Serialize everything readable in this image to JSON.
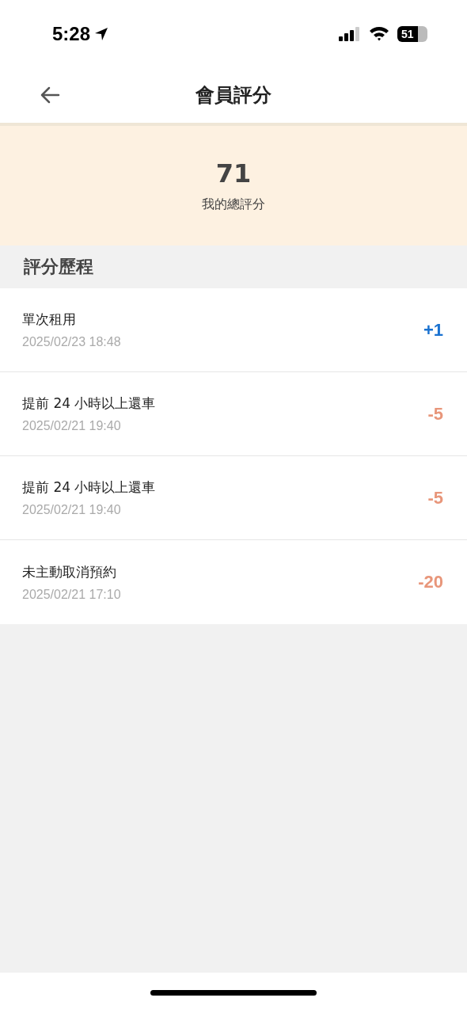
{
  "status_bar": {
    "time": "5:28",
    "battery": "51"
  },
  "header": {
    "title": "會員評分"
  },
  "summary": {
    "score": "71",
    "label": "我的總評分"
  },
  "section": {
    "title": "評分歷程"
  },
  "records": [
    {
      "title": "單次租用",
      "date": "2025/02/23 18:48",
      "points": "+1",
      "kind": "gain"
    },
    {
      "title": "提前 24 小時以上還車",
      "date": "2025/02/21 19:40",
      "points": "-5",
      "kind": "loss"
    },
    {
      "title": "提前 24 小時以上還車",
      "date": "2025/02/21 19:40",
      "points": "-5",
      "kind": "loss"
    },
    {
      "title": "未主動取消預約",
      "date": "2025/02/21 17:10",
      "points": "-20",
      "kind": "loss"
    }
  ]
}
